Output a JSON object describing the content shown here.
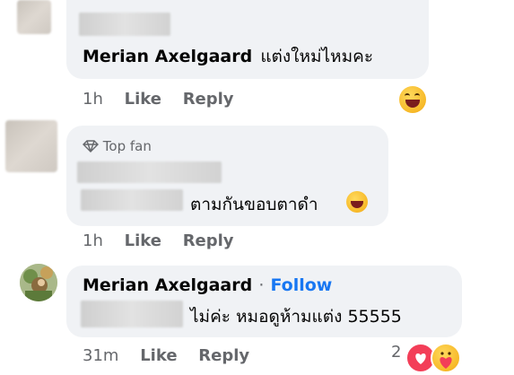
{
  "comments": [
    {
      "author": "Merian Axelgaard",
      "text": "แต่งใหม่ไหมคะ",
      "time": "1h",
      "like": "Like",
      "reply": "Reply"
    },
    {
      "badge": "Top fan",
      "text": "ตามกันขอบตาดำ",
      "time": "1h",
      "like": "Like",
      "reply": "Reply"
    },
    {
      "author": "Merian Axelgaard",
      "separator": "·",
      "follow": "Follow",
      "text": "ไม่ค่ะ หมอดูห้ามแต่ง 55555",
      "time": "31m",
      "like": "Like",
      "reply": "Reply",
      "reaction_count": "2",
      "reaction_icons": [
        "love-icon",
        "care-icon"
      ]
    }
  ],
  "colors": {
    "bubble": "#f0f2f5",
    "meta": "#65676b",
    "link": "#1877f2",
    "love": "#f33e58"
  }
}
